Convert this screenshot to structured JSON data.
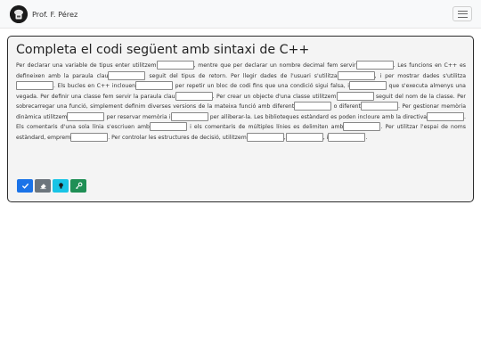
{
  "navbar": {
    "brand_name": "Prof. F. Pérez"
  },
  "exercise": {
    "title": "Completa el codi següent amb sintaxi de C++",
    "segments": [
      {
        "text": "Per declarar una variable de tipus enter utilitzem",
        "blank_width": 42
      },
      {
        "text": ", mentre que per declarar un nombre decimal fem servir",
        "blank_width": 42
      },
      {
        "text": ". Les funcions en C++ es defineixen amb la paraula clau",
        "blank_width": 42
      },
      {
        "text": " seguit del tipus de retorn. Per llegir dades de l'usuari s'utilitza",
        "blank_width": 42
      },
      {
        "text": ", i per mostrar dades s'utilitza",
        "blank_width": 42
      },
      {
        "text": ". Els bucles en C++ inclouen",
        "blank_width": 42
      },
      {
        "text": " per repetir un bloc de codi fins que una condició sigui falsa, i",
        "blank_width": 42
      },
      {
        "text": " que s'executa almenys una vegada. Per definir una classe fem servir la paraula clau",
        "blank_width": 42
      },
      {
        "text": ". Per crear un objecte d'una classe utilitzem",
        "blank_width": 42
      },
      {
        "text": " seguit del nom de la classe. Per sobrecarregar una funció, simplement definim diverses versions de la mateixa funció amb diferent",
        "blank_width": 42
      },
      {
        "text": " o diferent",
        "blank_width": 42
      },
      {
        "text": ". Per gestionar memòria dinàmica utilitzem",
        "blank_width": 42
      },
      {
        "text": " per reservar memòria i",
        "blank_width": 42
      },
      {
        "text": " per alliberar-la. Les biblioteques estàndard es poden incloure amb la directiva",
        "blank_width": 42
      },
      {
        "text": ". Els comentaris d'una sola línia s'escriuen amb",
        "blank_width": 42
      },
      {
        "text": " i els comentaris de múltiples línies es delimiten amb",
        "blank_width": 42
      },
      {
        "text": ". Per utilitzar l'espai de noms estàndard, emprem",
        "blank_width": 42
      },
      {
        "text": ". Per controlar les estructures de decisió, utilitzem",
        "blank_width": 42
      },
      {
        "text": ",",
        "blank_width": 42
      },
      {
        "text": ", i",
        "blank_width": 42
      },
      {
        "text": ".",
        "blank_width": 0
      }
    ]
  },
  "buttons": {
    "check_icon": "check-icon",
    "erase_icon": "eraser-icon",
    "hint_icon": "lightbulb-icon",
    "solution_icon": "key-icon"
  },
  "colors": {
    "check": "#1a73e8",
    "erase": "#6c757d",
    "hint": "#18c4e6",
    "solution": "#1f8f55",
    "card_border": "#2b2b2b",
    "card_bg": "#f4f4f4"
  }
}
